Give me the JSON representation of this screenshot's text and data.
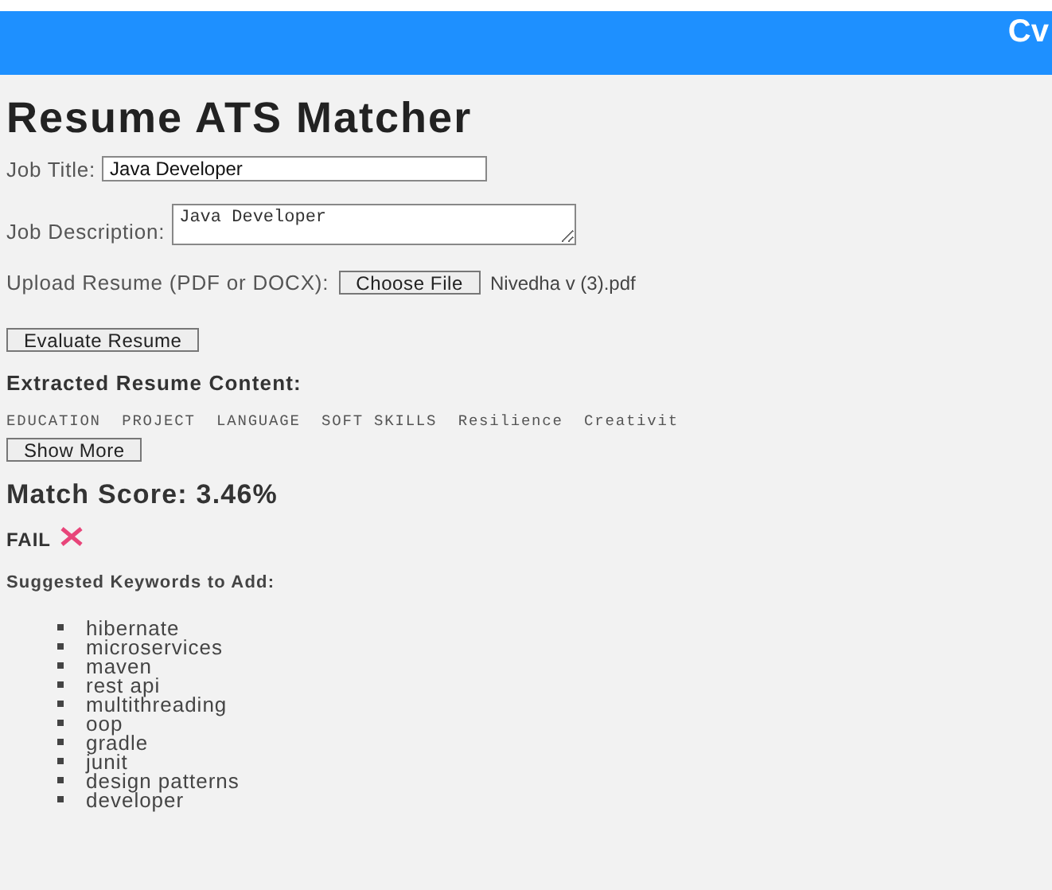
{
  "header": {
    "brand": "Cv"
  },
  "title": "Resume ATS Matcher",
  "form": {
    "job_title": {
      "label": "Job Title:",
      "value": "Java Developer"
    },
    "job_description": {
      "label": "Job Description:",
      "value": "Java Developer"
    },
    "upload": {
      "label": "Upload Resume (PDF or DOCX):",
      "button": "Choose File",
      "file_name": "Nivedha v (3).pdf"
    },
    "submit": "Evaluate Resume"
  },
  "extracted": {
    "heading": "Extracted Resume Content:",
    "text": "EDUCATION  PROJECT  LANGUAGE  SOFT SKILLS  Resilience  Creativit",
    "button": "Show More"
  },
  "result": {
    "score": "Match Score: 3.46%",
    "status": "FAIL",
    "passed": false
  },
  "suggestions": {
    "heading": "Suggested Keywords to Add:",
    "keywords": [
      "hibernate",
      "microservices",
      "maven",
      "rest api",
      "multithreading",
      "oop",
      "gradle",
      "junit",
      "design patterns",
      "developer"
    ]
  }
}
